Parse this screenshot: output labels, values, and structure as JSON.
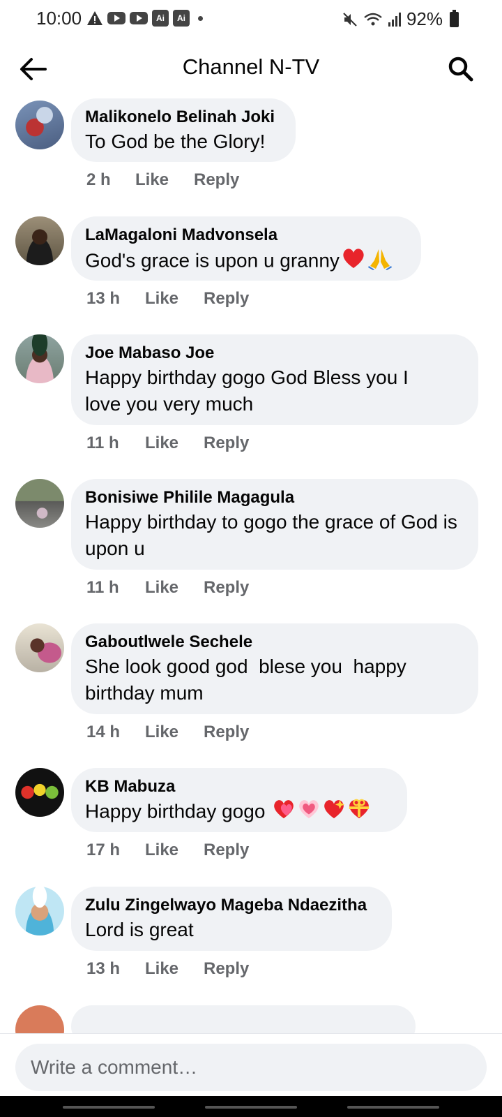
{
  "status_bar": {
    "time": "10:00",
    "battery": "92%"
  },
  "header": {
    "title": "Channel N-TV"
  },
  "comments": [
    {
      "author": "Malikonelo Belinah Joki",
      "text": "To God be the Glory!",
      "time": "2 h",
      "like": "Like",
      "reply": "Reply"
    },
    {
      "author": "LaMagaloni Madvonsela",
      "text": "God's grace is upon u granny",
      "time": "13 h",
      "like": "Like",
      "reply": "Reply"
    },
    {
      "author": "Joe Mabaso Joe",
      "text": "Happy birthday gogo God Bless you I love you very much",
      "time": "11 h",
      "like": "Like",
      "reply": "Reply"
    },
    {
      "author": "Bonisiwe Philile Magagula",
      "text": "Happy birthday to gogo the grace of God is upon u",
      "time": "11 h",
      "like": "Like",
      "reply": "Reply"
    },
    {
      "author": "Gaboutlwele Sechele",
      "text": "She look good god  blese you  happy birthday mum",
      "time": "14 h",
      "like": "Like",
      "reply": "Reply"
    },
    {
      "author": "KB Mabuza",
      "text": "Happy birthday gogo",
      "time": "17 h",
      "like": "Like",
      "reply": "Reply"
    },
    {
      "author": "Zulu Zingelwayo Mageba Ndaezitha",
      "text": "Lord is great",
      "time": "13 h",
      "like": "Like",
      "reply": "Reply"
    }
  ],
  "composer": {
    "placeholder": "Write a comment…"
  },
  "icons": {
    "back": "arrow-left-icon",
    "search": "search-icon"
  }
}
